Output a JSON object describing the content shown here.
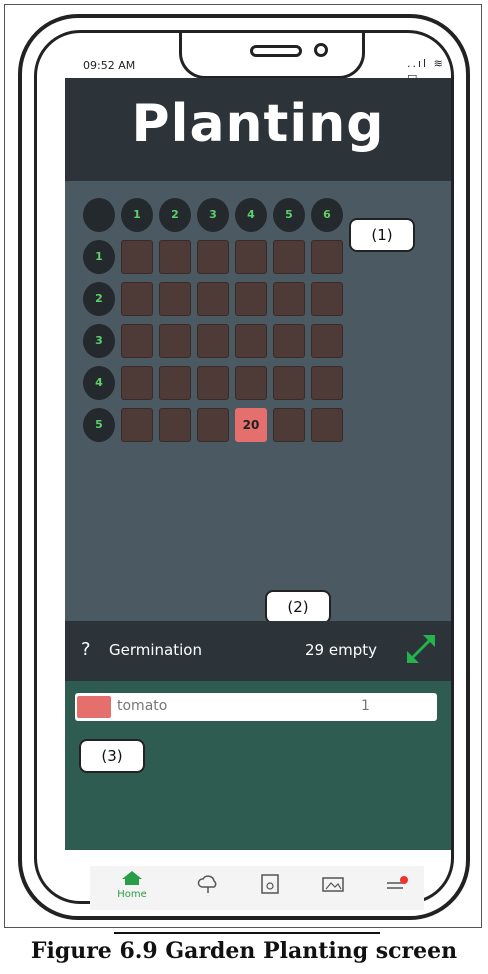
{
  "status": {
    "time": "09:52 AM",
    "icons": "..ıl ≋ ▭"
  },
  "header": {
    "title": "Planting"
  },
  "grid": {
    "col_headers": [
      "1",
      "2",
      "3",
      "4",
      "5",
      "6"
    ],
    "row_headers": [
      "1",
      "2",
      "3",
      "4",
      "5"
    ],
    "filled_cell": {
      "row": 5,
      "col": 4,
      "value": "20"
    }
  },
  "annotations": {
    "a1": "(1)",
    "a2": "(2)",
    "a3": "(3)"
  },
  "info_bar": {
    "help": "?",
    "label": "Germination",
    "empty": "29 empty"
  },
  "plants": [
    {
      "name": "tomato",
      "count": "1",
      "color": "#e46f6d"
    }
  ],
  "nav": {
    "home_label": "Home"
  },
  "caption": "Figure 6.9 Garden Planting screen",
  "colors": {
    "header_bg": "#2c3339",
    "grid_bg": "#4b5962",
    "plot": "#4e3a36",
    "accent_green": "#2a9d48",
    "list_bg": "#2f5c50"
  }
}
